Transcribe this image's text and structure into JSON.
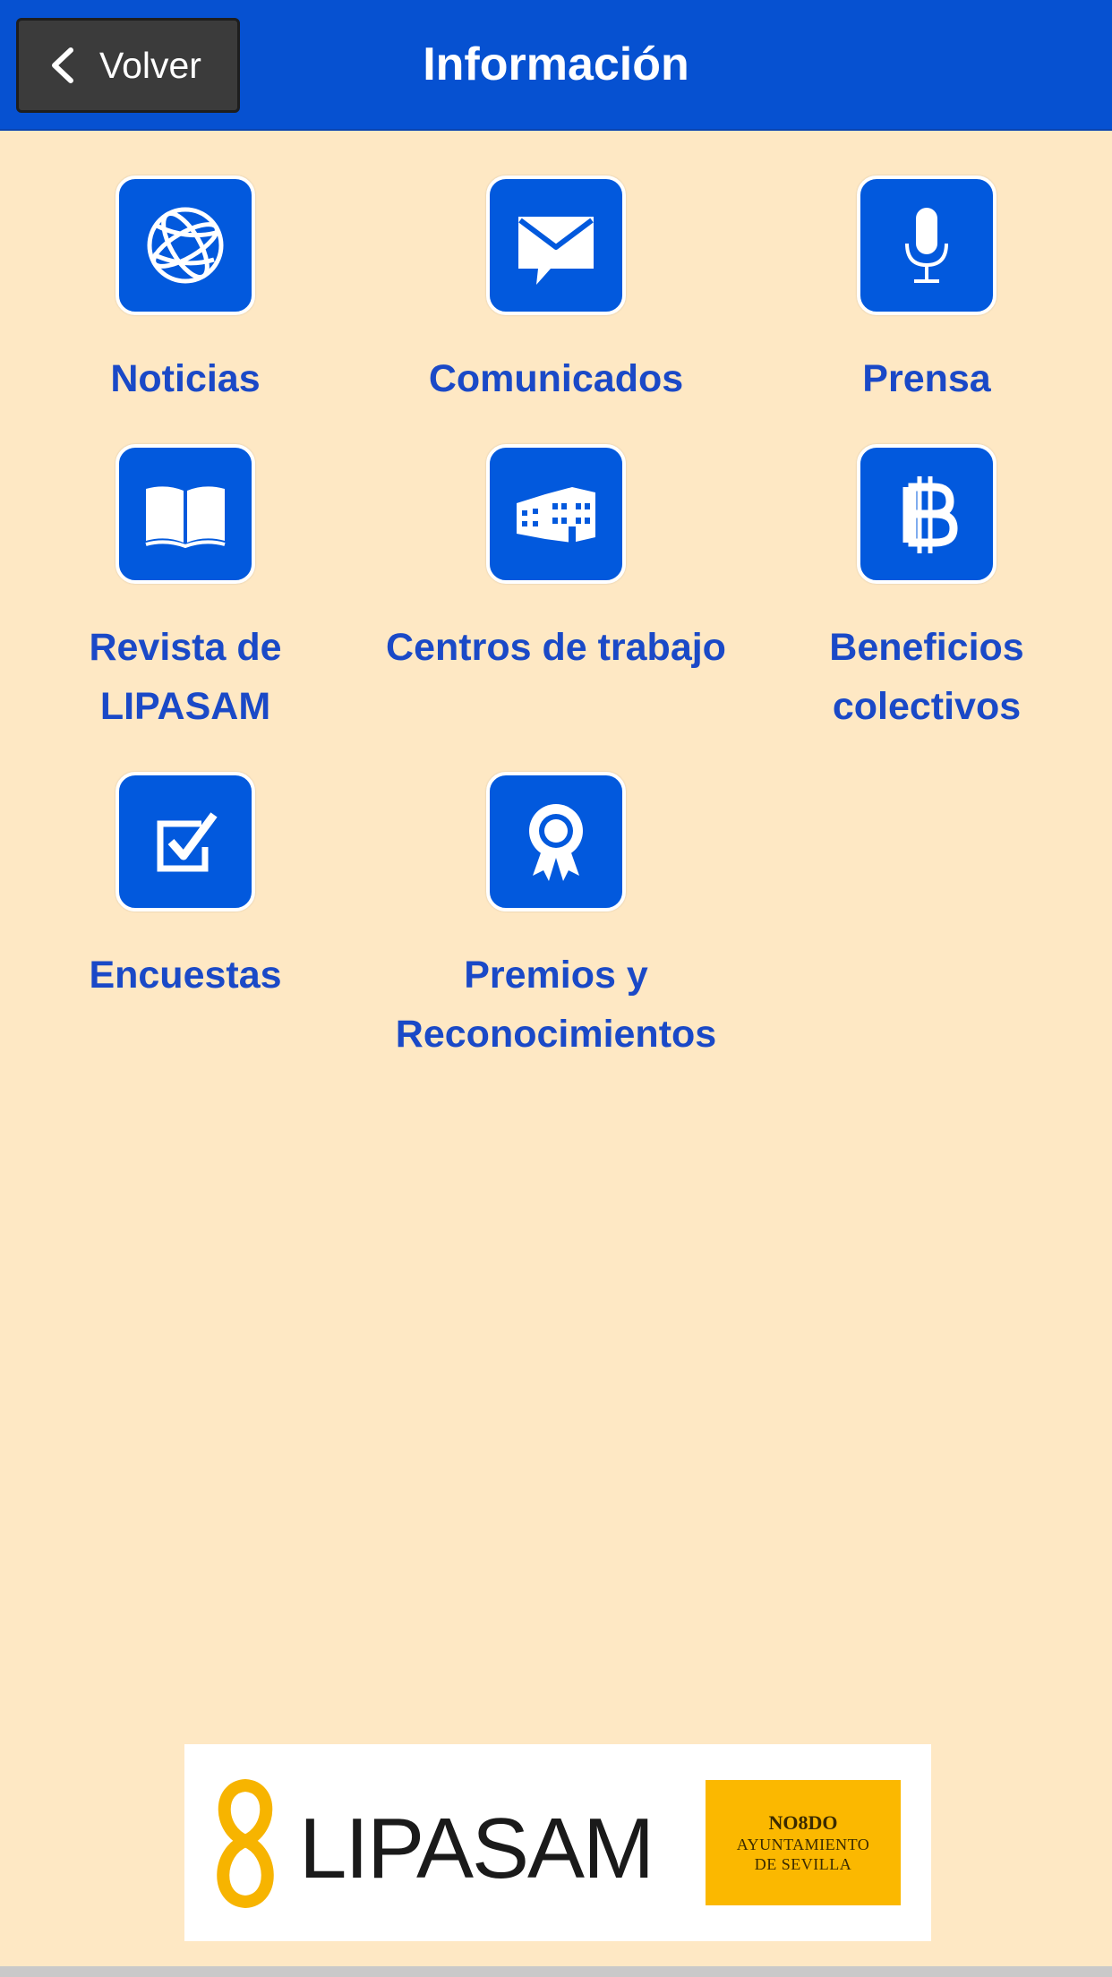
{
  "header": {
    "back_label": "Volver",
    "title": "Información"
  },
  "grid": {
    "items": [
      {
        "label": "Noticias",
        "icon": "globe-icon"
      },
      {
        "label": "Comunicados",
        "icon": "envelope-chat-icon"
      },
      {
        "label": "Prensa",
        "icon": "microphone-icon"
      },
      {
        "label": "Revista de\nLIPASAM",
        "icon": "open-book-icon"
      },
      {
        "label": "Centros de trabajo",
        "icon": "building-icon"
      },
      {
        "label": "Beneficios\ncolectivos",
        "icon": "baht-currency-icon"
      },
      {
        "label": "Encuestas",
        "icon": "checkbox-icon"
      },
      {
        "label": "Premios y\nReconocimientos",
        "icon": "award-ribbon-icon"
      }
    ]
  },
  "footer": {
    "logo_text": "LIPASAM",
    "seal_motto": "NO8DO",
    "seal_line1": "AYUNTAMIENTO",
    "seal_line2": "DE SEVILLA"
  },
  "colors": {
    "header_bg": "#0651d1",
    "page_bg": "#fee8c4",
    "tile_bg": "#0259dd",
    "label_text": "#1a49c7",
    "back_button_bg": "#3b3b3b",
    "logo_yellow": "#fbb800"
  }
}
